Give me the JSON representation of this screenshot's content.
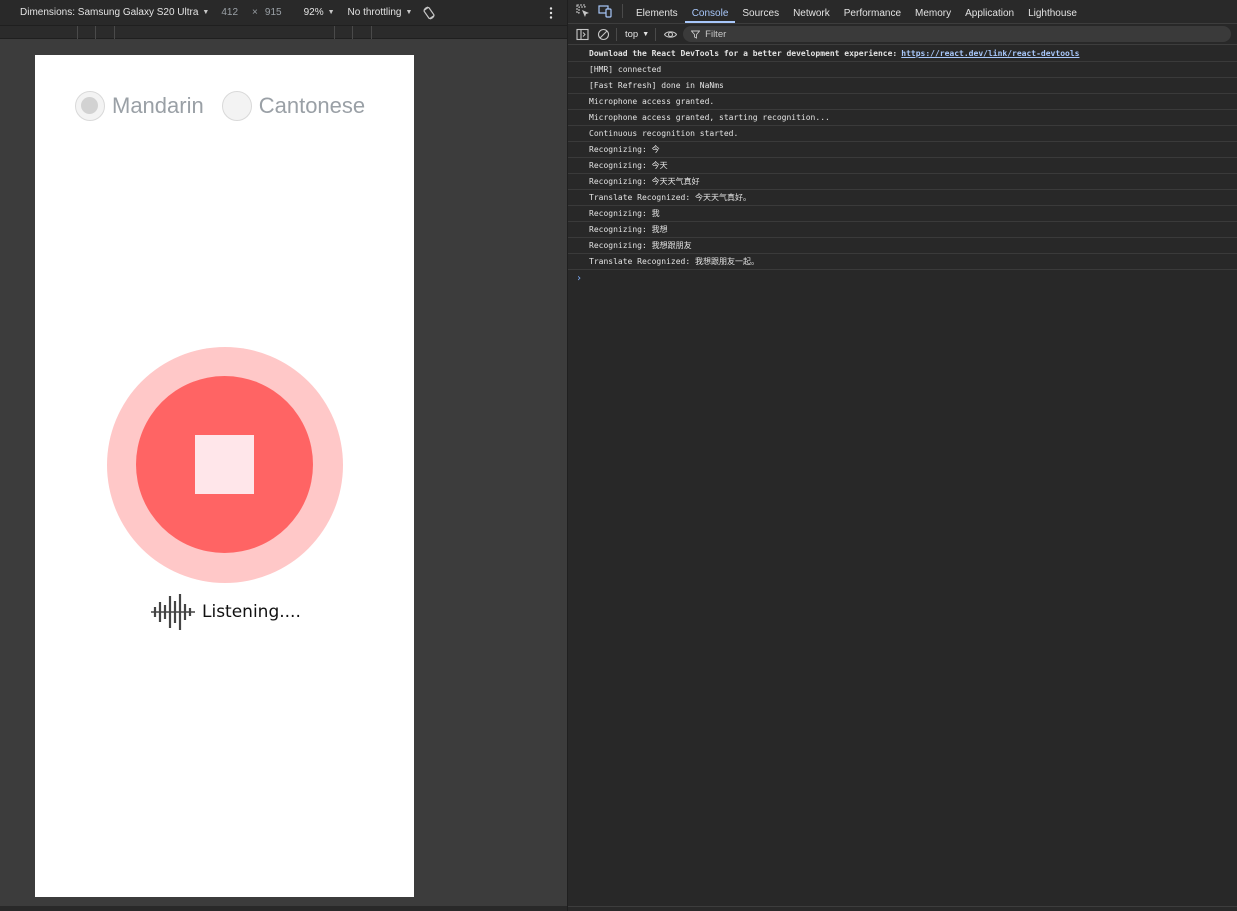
{
  "device_toolbar": {
    "dimensions_label": "Dimensions: Samsung Galaxy S20 Ultra",
    "width": "412",
    "times": "×",
    "height": "915",
    "zoom": "92%",
    "throttling": "No throttling"
  },
  "app": {
    "languages": [
      {
        "label": "Mandarin",
        "checked": true
      },
      {
        "label": "Cantonese",
        "checked": false
      }
    ],
    "status": "Listening....",
    "colors": {
      "outer_ring": "#ffc8c8",
      "inner_circle": "#ff6464",
      "stop_square": "#ffe6ea"
    }
  },
  "devtools": {
    "tabs": [
      "Elements",
      "Console",
      "Sources",
      "Network",
      "Performance",
      "Memory",
      "Application",
      "Lighthouse"
    ],
    "active_tab": "Console",
    "context": "top",
    "filter_placeholder": "Filter",
    "messages": [
      {
        "text": "Download the React DevTools for a better development experience:",
        "link": "https://react.dev/link/react-devtools"
      },
      {
        "text": "[HMR] connected"
      },
      {
        "text": "[Fast Refresh] done in NaNms"
      },
      {
        "text": "Microphone access granted."
      },
      {
        "text": "Microphone access granted, starting recognition..."
      },
      {
        "text": "Continuous recognition started."
      },
      {
        "text": "Recognizing: 今"
      },
      {
        "text": "Recognizing: 今天"
      },
      {
        "text": "Recognizing: 今天天气真好"
      },
      {
        "text": "Translate Recognized: 今天天气真好。"
      },
      {
        "text": "Recognizing: 我"
      },
      {
        "text": "Recognizing: 我想"
      },
      {
        "text": "Recognizing: 我想跟朋友"
      },
      {
        "text": "Translate Recognized: 我想跟朋友一起。"
      }
    ],
    "prompt": "›"
  }
}
